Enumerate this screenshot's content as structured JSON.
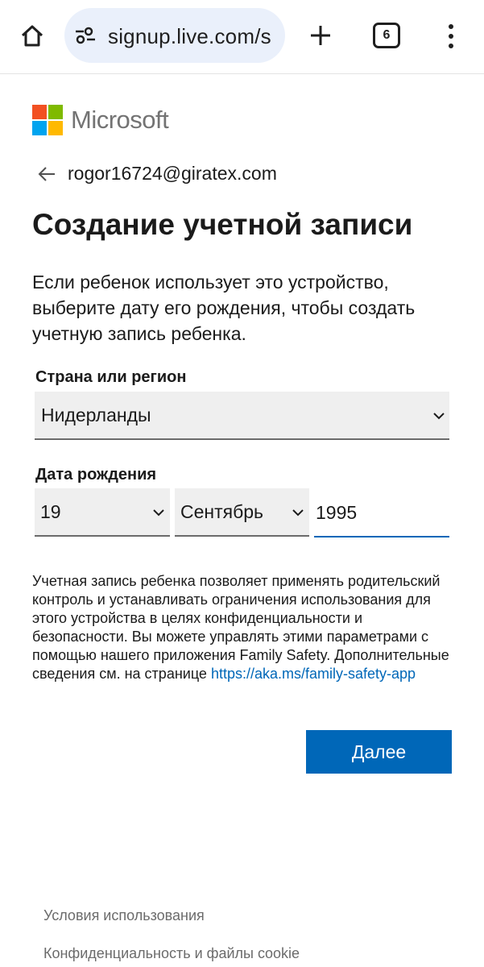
{
  "browser": {
    "url": "signup.live.com/s",
    "tab_count": "6"
  },
  "brand": {
    "name": "Microsoft",
    "colors": {
      "red": "#f25022",
      "green": "#7fba00",
      "blue": "#00a4ef",
      "yellow": "#ffb900"
    }
  },
  "account": {
    "email": "rogor16724@giratex.com"
  },
  "page": {
    "title": "Создание учетной записи",
    "description": "Если ребенок использует это устройство, выберите дату его рождения, чтобы создать учетную запись ребенка."
  },
  "form": {
    "country_label": "Страна или регион",
    "country_value": "Нидерланды",
    "dob_label": "Дата рождения",
    "day_value": "19",
    "month_value": "Сентябрь",
    "year_value": "1995"
  },
  "notice": {
    "text": "Учетная запись ребенка позволяет применять родительский контроль и устанавливать ограничения использования для этого устройства в целях конфиденциальности и безопасности. Вы можете управлять этими параметрами с помощью нашего приложения Family Safety. Дополнительные сведения см. на странице ",
    "link_text": "https://aka.ms/family-safety-app"
  },
  "actions": {
    "next_label": "Далее"
  },
  "footer": {
    "terms": "Условия использования",
    "privacy": "Конфиденциальность и файлы cookie"
  },
  "theme": {
    "accent": "#0067b8"
  }
}
